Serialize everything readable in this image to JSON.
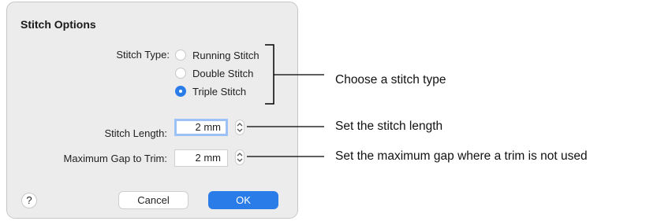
{
  "dialog": {
    "title": "Stitch Options",
    "stitch_type": {
      "label": "Stitch Type:",
      "options": [
        {
          "label": "Running Stitch",
          "selected": false
        },
        {
          "label": "Double Stitch",
          "selected": false
        },
        {
          "label": "Triple Stitch",
          "selected": true
        }
      ]
    },
    "stitch_length": {
      "label": "Stitch Length:",
      "value": "2 mm"
    },
    "max_gap": {
      "label": "Maximum Gap to Trim:",
      "value": "2 mm"
    },
    "help_label": "?",
    "cancel_label": "Cancel",
    "ok_label": "OK"
  },
  "callouts": {
    "stitch_type": "Choose a stitch type",
    "stitch_length": "Set the stitch length",
    "max_gap": "Set the maximum gap where a trim is not used"
  },
  "colors": {
    "accent": "#2a7ce9",
    "dialog_bg": "#ececec",
    "focus_ring": "#9cc2f5"
  }
}
